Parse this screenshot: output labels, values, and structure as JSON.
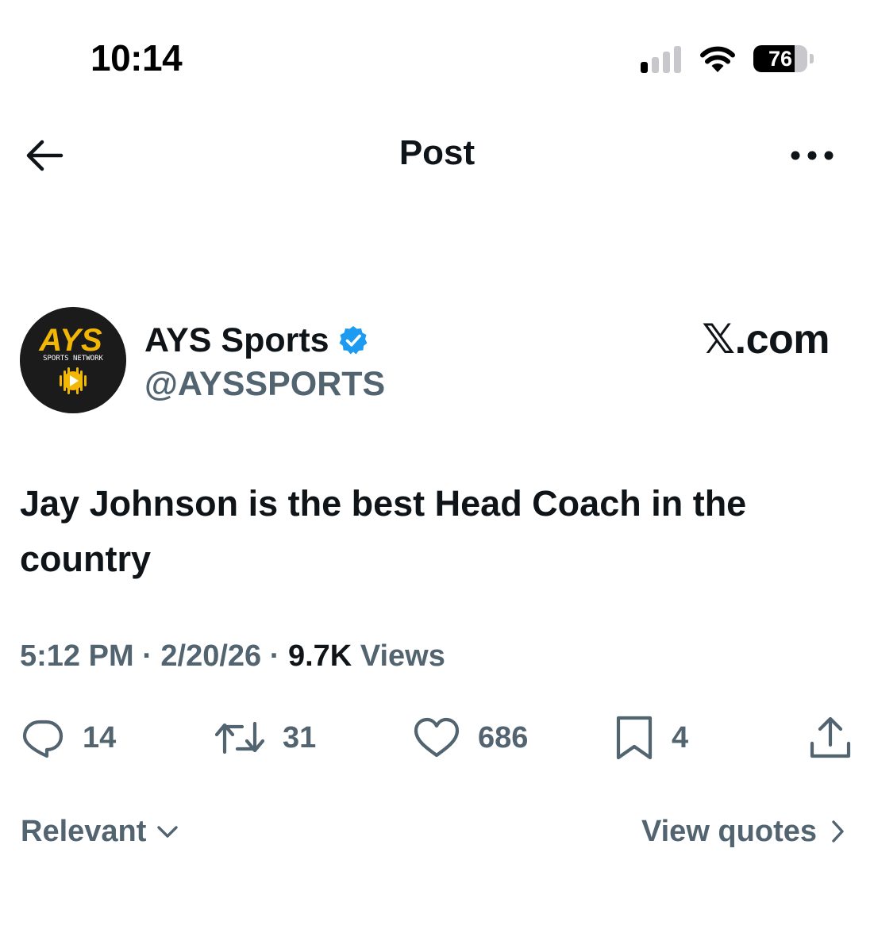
{
  "status_bar": {
    "time": "10:14",
    "battery": "76",
    "battery_level": 0.76,
    "signal_bars_active": 1,
    "icons": [
      "cellular-signal-icon",
      "wifi-icon",
      "battery-icon"
    ]
  },
  "header": {
    "title": "Post",
    "back_icon": "arrow-left-icon",
    "more_icon": "ellipsis-icon"
  },
  "author": {
    "display_name": "AYS Sports",
    "handle": "@AYSSPORTS",
    "verified": true,
    "verified_color": "#1d9bf0",
    "avatar": {
      "logo_text": "AYS",
      "subtitle": "SPORTS NETWORK",
      "accent": "#f2b705"
    }
  },
  "watermark": "𝕏.com",
  "post": {
    "text": "Jay Johnson is the best Head Coach in the country",
    "time": "5:12 PM",
    "separator": "·",
    "date": "2/20/26",
    "views_count": "9.7K",
    "views_label": "Views"
  },
  "actions": {
    "replies": "14",
    "reposts": "31",
    "likes": "686",
    "bookmarks": "4"
  },
  "footer": {
    "sort_label": "Relevant",
    "view_quotes_label": "View quotes"
  },
  "colors": {
    "text_primary": "#0f1419",
    "text_secondary": "#536471",
    "background": "#ffffff"
  }
}
